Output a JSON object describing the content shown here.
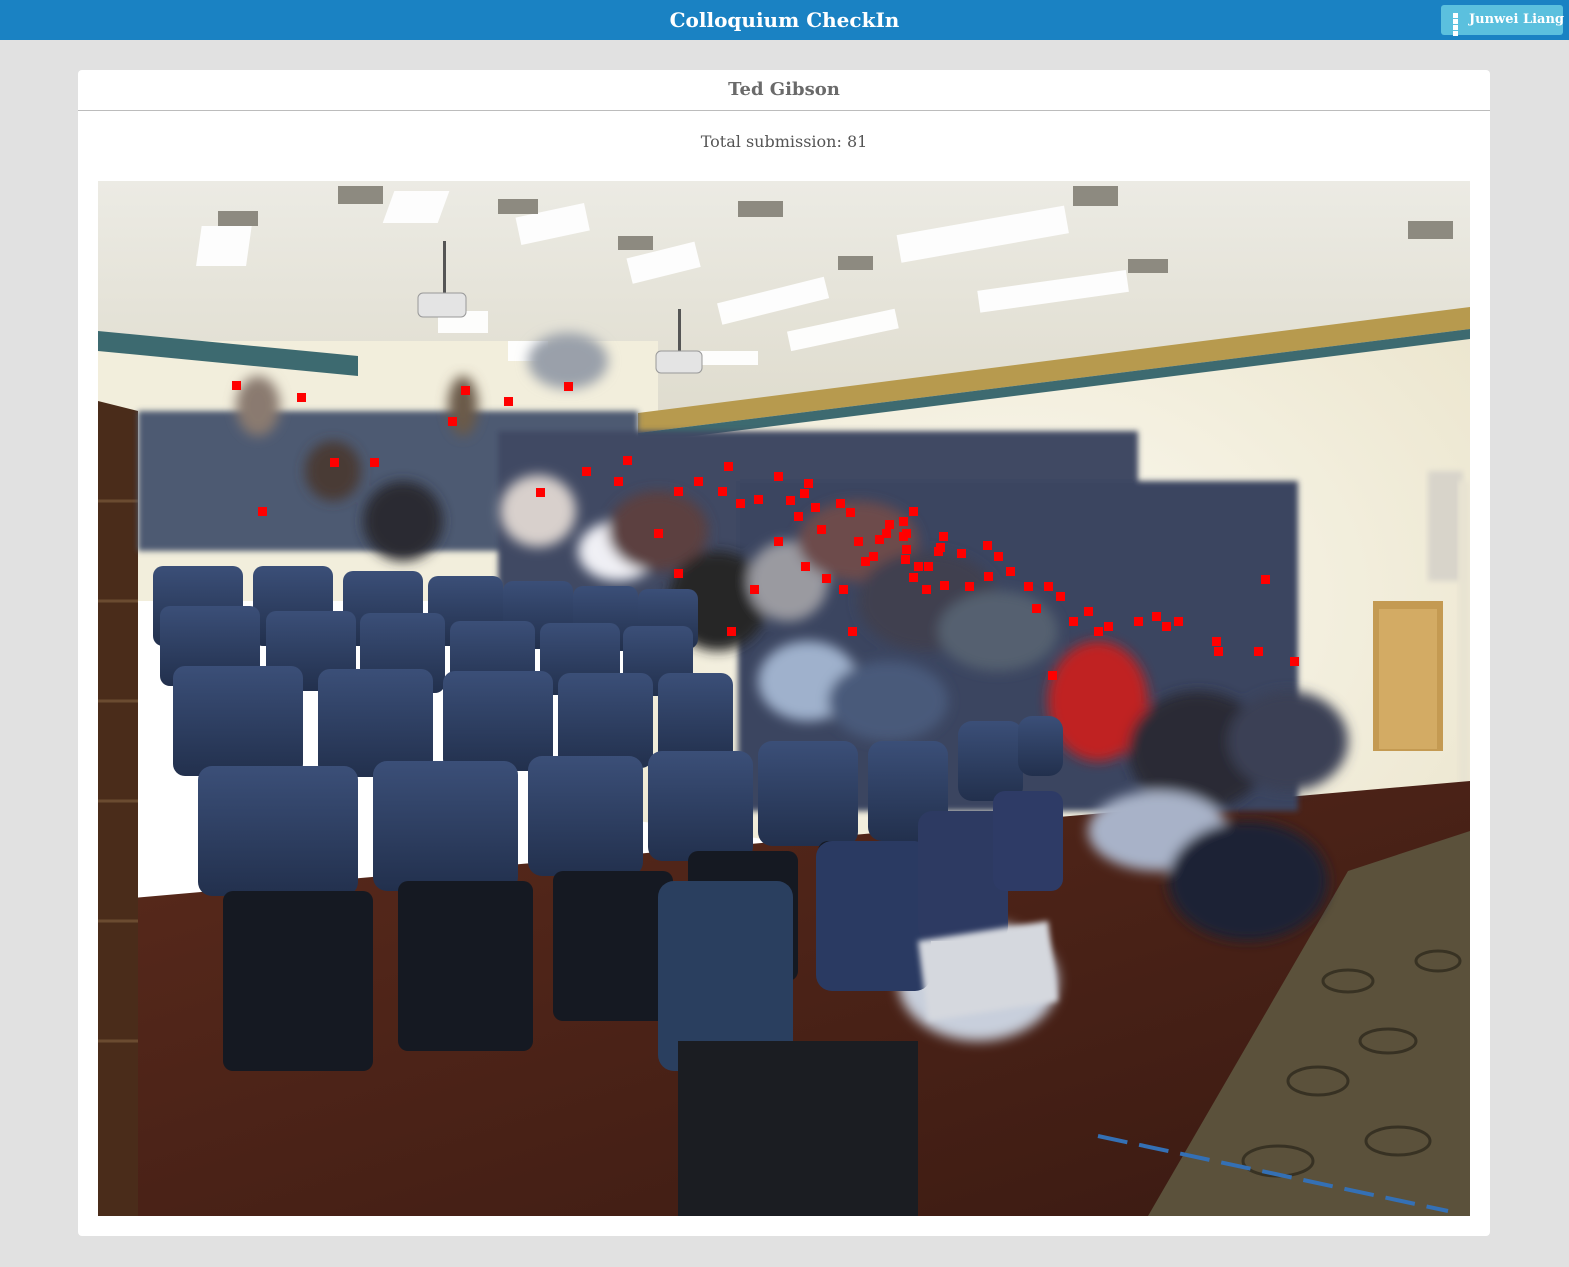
{
  "app": {
    "title": "Colloquium CheckIn"
  },
  "user": {
    "name": "Junwei Liang",
    "icon": "grid-icon"
  },
  "event": {
    "speaker": "Ted Gibson",
    "total_label": "Total submission: 81"
  },
  "colors": {
    "header": "#1a82c3",
    "user_button": "#5bc0de",
    "marker": "#ff0000",
    "background": "#e1e1e1"
  }
}
